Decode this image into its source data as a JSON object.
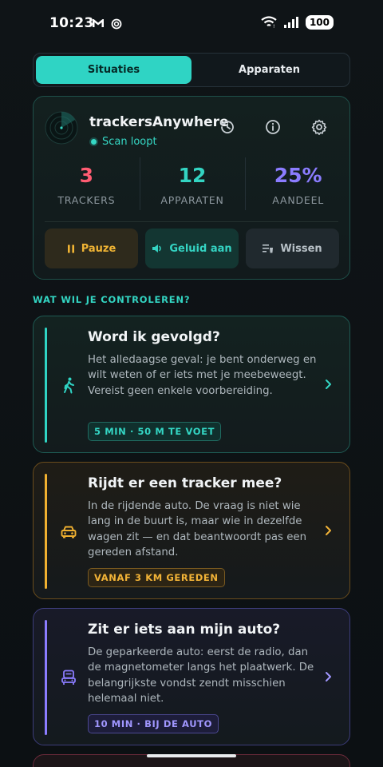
{
  "status_bar": {
    "time": "10:23",
    "battery": "100"
  },
  "tabs": [
    {
      "label": "Situaties",
      "active": true
    },
    {
      "label": "Apparaten",
      "active": false
    }
  ],
  "main_card": {
    "title": "trackersAnywhere",
    "scan_status": "Scan loopt",
    "header_icons": [
      "history-icon",
      "info-icon",
      "gear-icon"
    ],
    "stats": [
      {
        "value": "3",
        "label": "TRACKERS",
        "color": "#ff5c72"
      },
      {
        "value": "12",
        "label": "APPARATEN",
        "color": "#33d4c2"
      },
      {
        "value": "25%",
        "label": "AANDEEL",
        "color": "#8b7cff"
      }
    ],
    "buttons": {
      "pause": "Pauze",
      "sound": "Geluid aan",
      "clear": "Wissen"
    }
  },
  "section_title": "WAT WIL JE CONTROLEREN?",
  "scenarios": [
    {
      "title": "Word ik gevolgd?",
      "description": "Het alledaagse geval: je bent onderweg en wilt weten of er iets met je meebeweegt. Vereist geen enkele voorbereiding.",
      "tag": "5 MIN · 50 M TE VOET",
      "icon": "walking-icon",
      "color": "#2fd4c4"
    },
    {
      "title": "Rijdt er een tracker mee?",
      "description": "In de rijdende auto. De vraag is niet wie lang in de buurt is, maar wie in dezelfde wagen zit — en dat beantwoordt pas een gereden afstand.",
      "tag": "VANAF 3 KM GEREDEN",
      "icon": "car-icon",
      "color": "#f0b030"
    },
    {
      "title": "Zit er iets aan mijn auto?",
      "description": "De geparkeerde auto: eerst de radio, dan de magnetometer langs het plaatwerk. De belangrijkste vondst zendt misschien helemaal niet.",
      "tag": "10 MIN · BIJ DE AUTO",
      "icon": "car-seat-icon",
      "color": "#8b7cff"
    }
  ]
}
